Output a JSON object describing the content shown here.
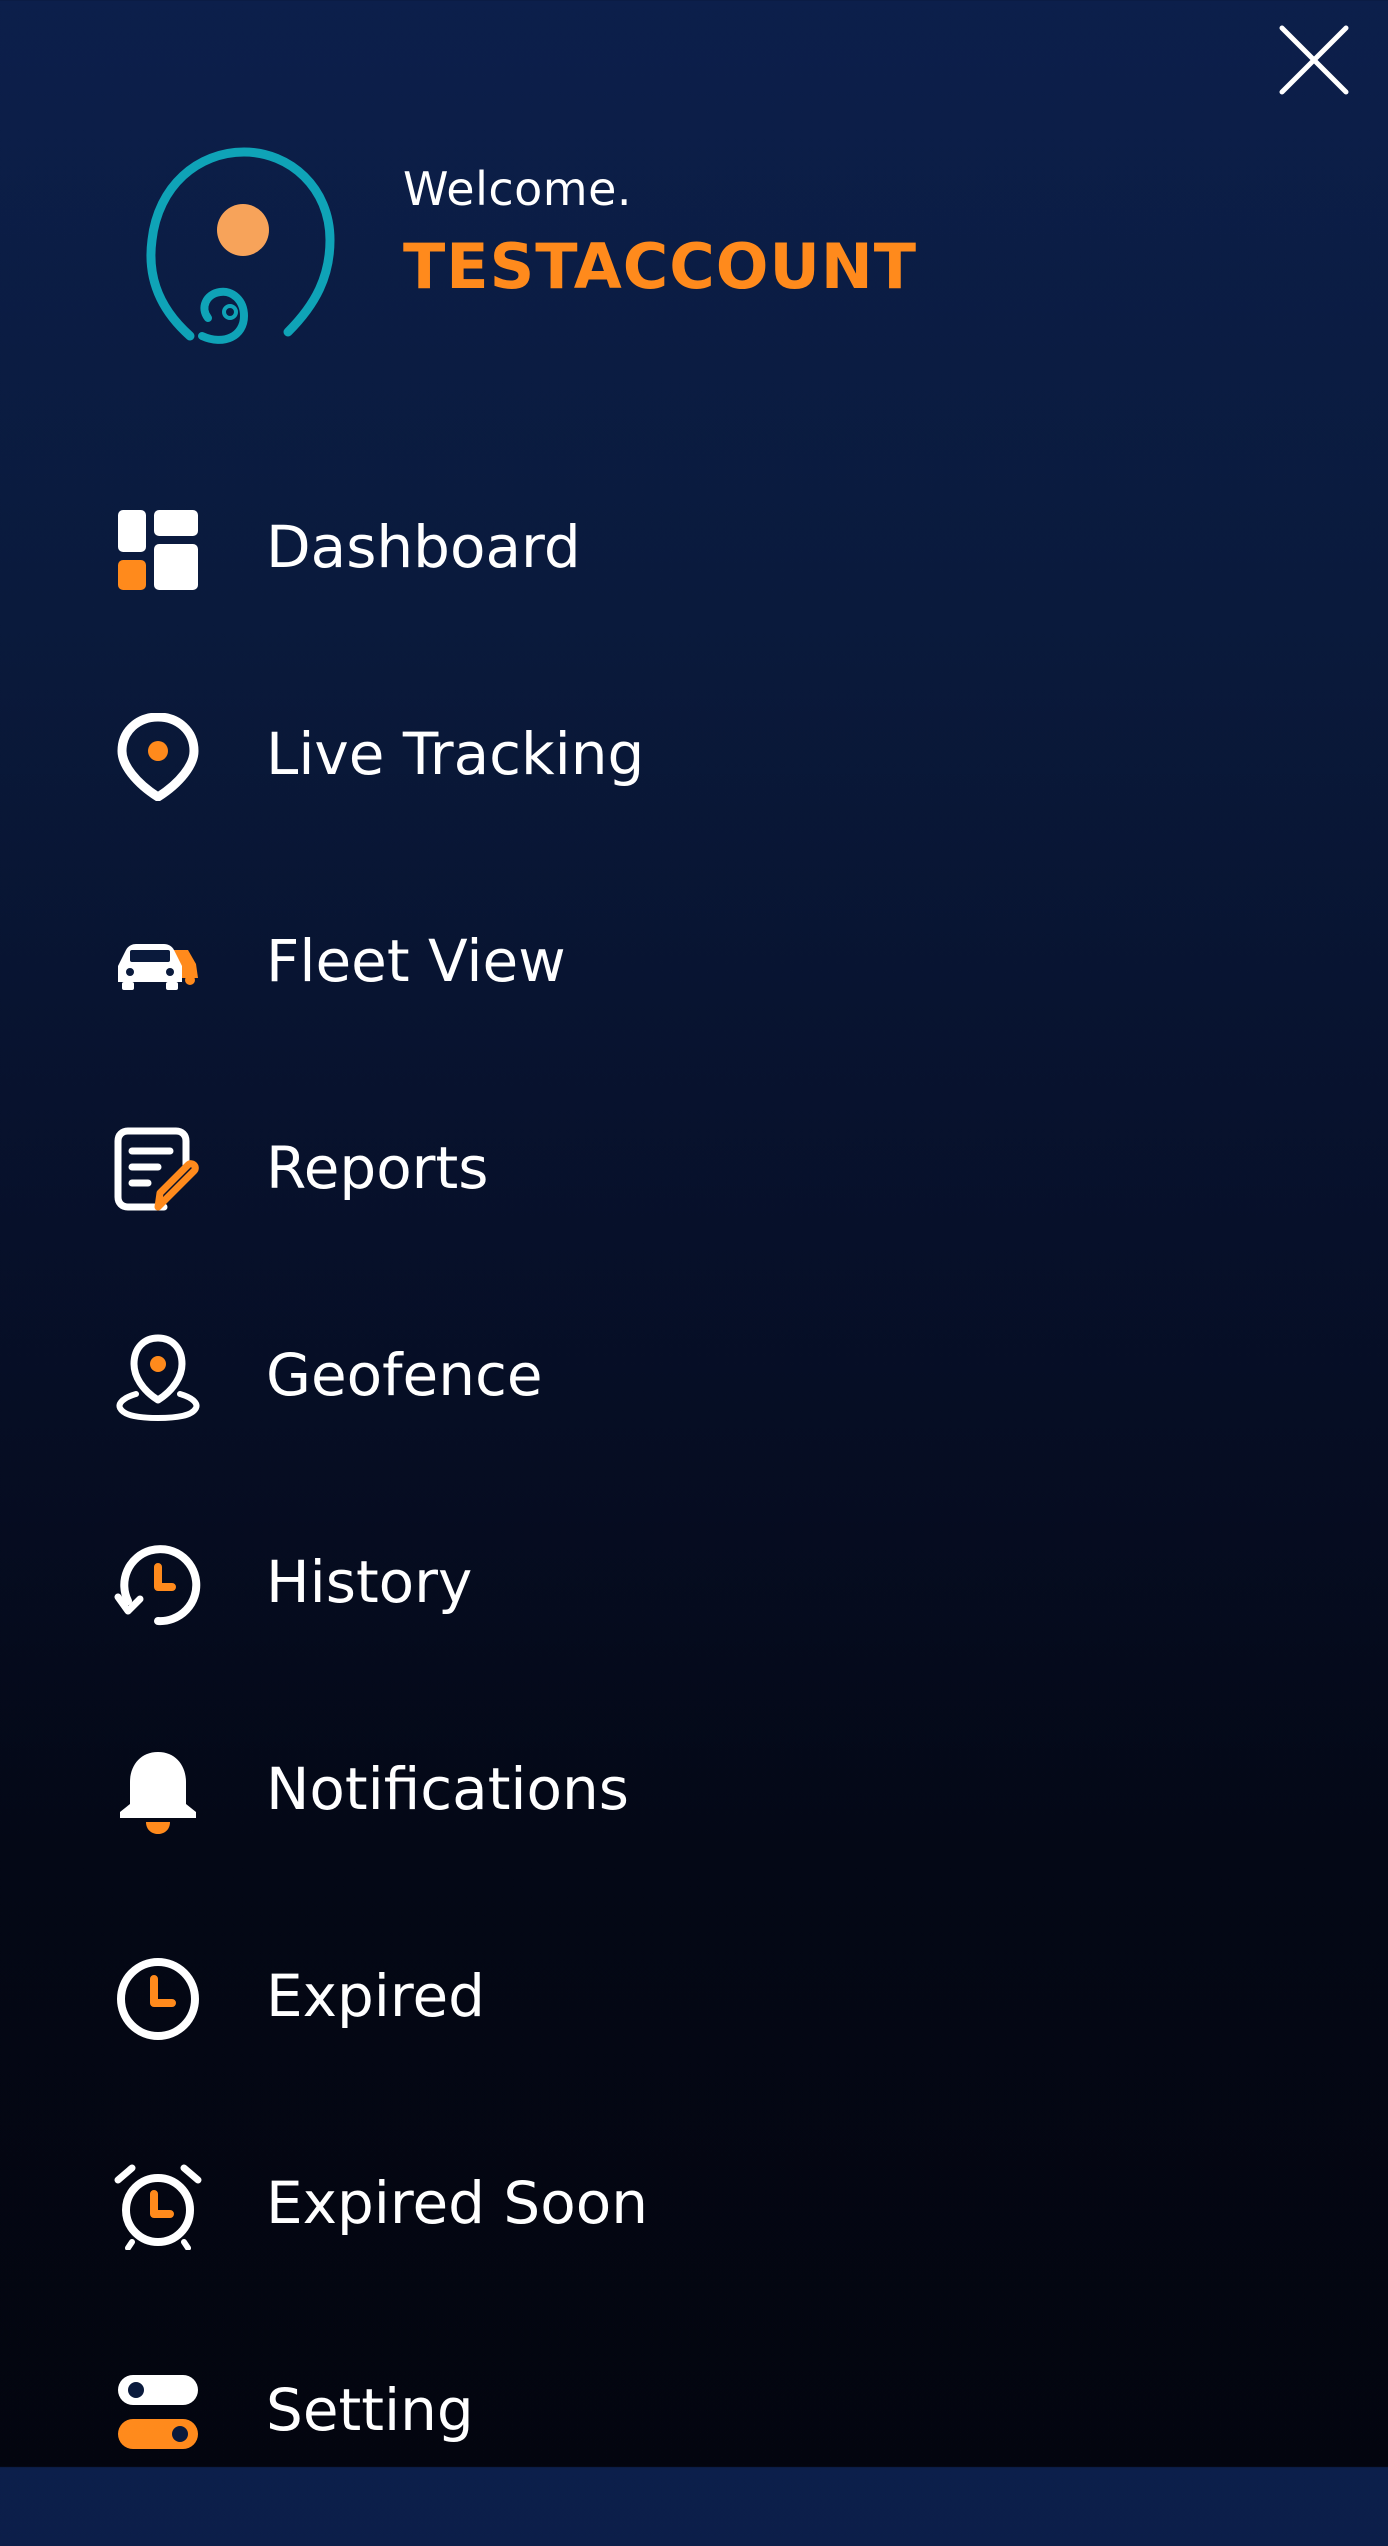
{
  "header": {
    "welcome": "Welcome.",
    "username": "TESTACCOUNT"
  },
  "colors": {
    "accent": "#ff8a1c",
    "logo_ring": "#0fa3b7",
    "logo_dot": "#f7a35a",
    "text": "#ffffff"
  },
  "menu": {
    "items": [
      {
        "label": "Dashboard",
        "icon": "dashboard-icon"
      },
      {
        "label": "Live Tracking",
        "icon": "location-pin-icon"
      },
      {
        "label": "Fleet View",
        "icon": "cars-icon"
      },
      {
        "label": "Reports",
        "icon": "report-edit-icon"
      },
      {
        "label": "Geofence",
        "icon": "geofence-pin-icon"
      },
      {
        "label": "History",
        "icon": "history-clock-icon"
      },
      {
        "label": "Notifications",
        "icon": "bell-icon"
      },
      {
        "label": "Expired",
        "icon": "clock-icon"
      },
      {
        "label": "Expired Soon",
        "icon": "alarm-clock-icon"
      },
      {
        "label": "Setting",
        "icon": "toggle-settings-icon"
      }
    ]
  }
}
